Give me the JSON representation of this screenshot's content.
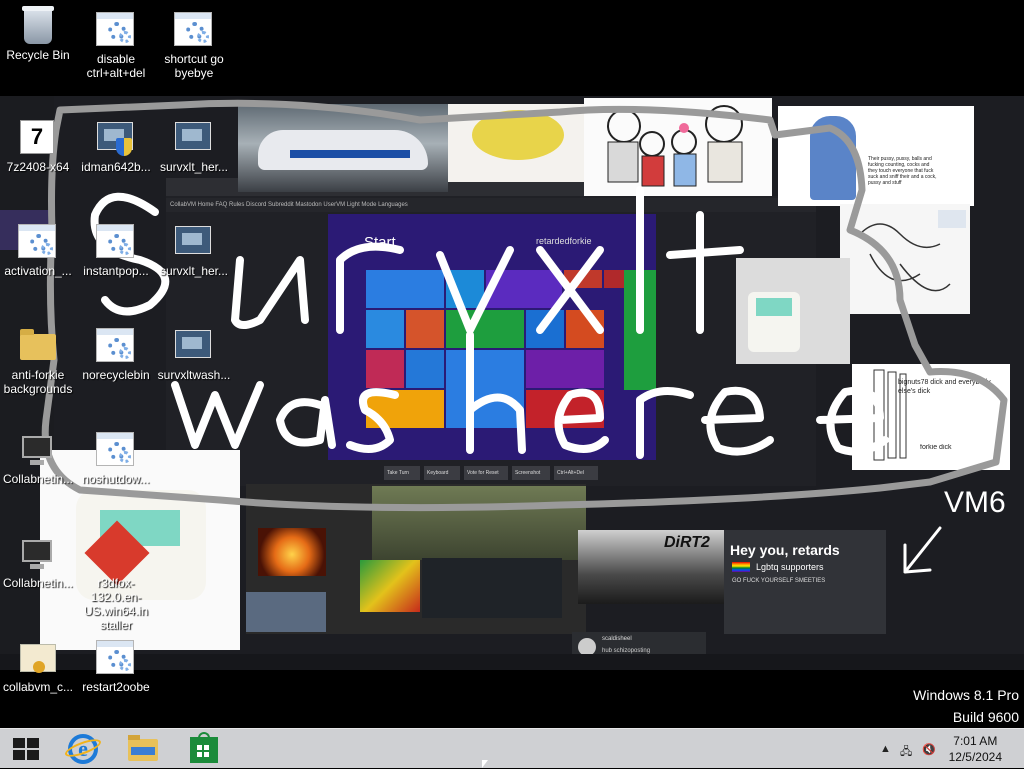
{
  "desktop_icons": [
    {
      "label": "Recycle Bin",
      "icon": "recycle-bin-icon"
    },
    {
      "label": "disable ctrl+alt+del",
      "icon": "script-settings-icon"
    },
    {
      "label": "shortcut go byebye",
      "icon": "script-settings-icon"
    },
    {
      "label": "7z2408-x64",
      "icon": "7zip-installer-icon"
    },
    {
      "label": "idman642b...",
      "icon": "installer-shield-icon"
    },
    {
      "label": "survxlt_her...",
      "icon": "screenshot-image-icon"
    },
    {
      "label": "activation_...",
      "icon": "script-settings-icon"
    },
    {
      "label": "instantpop...",
      "icon": "script-settings-icon"
    },
    {
      "label": "survxlt_her...",
      "icon": "screenshot-image-icon"
    },
    {
      "label": "anti-forkie backgrounds",
      "icon": "folder-icon"
    },
    {
      "label": "norecyclebin",
      "icon": "script-settings-icon"
    },
    {
      "label": "survxltwash...",
      "icon": "screenshot-image-icon"
    },
    {
      "label": "Collabnetin...",
      "icon": "network-computer-icon"
    },
    {
      "label": "noshutdow...",
      "icon": "script-settings-icon"
    },
    {
      "label": "Collabnetin...",
      "icon": "network-computer-icon"
    },
    {
      "label": "r3dfox-132.0.en-US.win64.in staller",
      "icon": "installer-icon"
    },
    {
      "label": "collabvm_c...",
      "icon": "certificate-icon"
    },
    {
      "label": "restart2oobe",
      "icon": "script-settings-icon"
    }
  ],
  "scribble": {
    "line1": "survxlt",
    "line2": "was here",
    "tag": "VM6",
    "color": "#ffffff",
    "loop_color": "#9a9a9a"
  },
  "wallpaper": {
    "start_screen_title": "Start",
    "start_screen_user": "retardedforkie",
    "inner_toolbar": "CollabVM  Home  FAQ  Rules  Discord  Subreddit  Mastodon  UserVM  Light Mode  Languages",
    "inner_buttons": [
      "Take Turn",
      "Keyboard",
      "Vote for Reset",
      "Screenshot",
      "Ctrl+Alt+Del"
    ],
    "cat_text": "Their pussy, pussy, balls and fucking counting, cocks and they touch everyone that fuck suck and sniff their and a cock, pussy and stuff",
    "stickfig_text": "bignuts78 dick and everybody else's dick",
    "stickfig_text2": "forkie dick",
    "dirt_label": "DiRT2",
    "chat_title": "Hey you, retards",
    "chat_sub": "Lgbtq supporters",
    "chat_line": "GO FUCK YOURSELF SMEETIES",
    "msg_name": "scaldisheel",
    "msg_text": "hub schizoposting"
  },
  "watermark": {
    "line1": "Windows 8.1 Pro",
    "line2": "Build 9600"
  },
  "taskbar": {
    "pinned": [
      "start-button",
      "internet-explorer",
      "file-explorer",
      "windows-store"
    ],
    "time": "7:01 AM",
    "date": "12/5/2024",
    "tray_icons": [
      "show-hidden-icons-arrow",
      "network-icon",
      "volume-muted-icon"
    ]
  },
  "colors": {
    "taskbar_bg": "#cfd0d3",
    "desktop_bg": "#000000",
    "start_screen_bg": "#2b1a75"
  }
}
